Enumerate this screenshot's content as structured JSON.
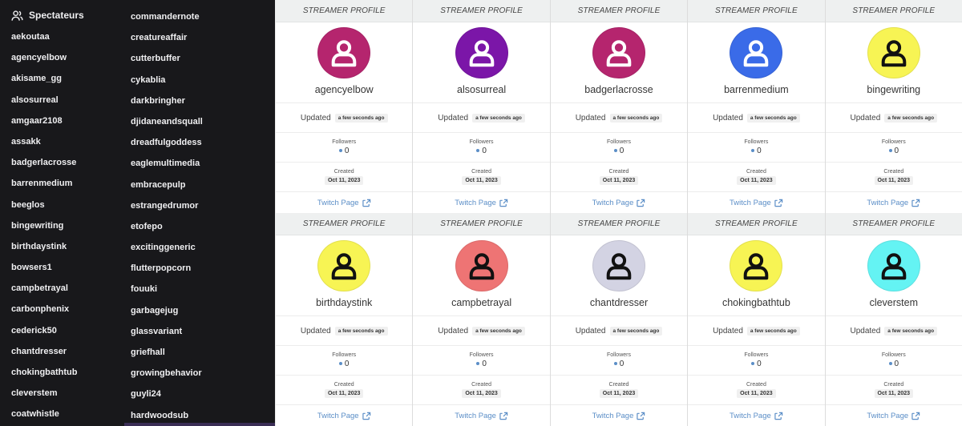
{
  "sidebar": {
    "title": "Spectateurs",
    "icon": "users-icon",
    "column1": [
      "aekoutaa",
      "agencyelbow",
      "akisame_gg",
      "alsosurreal",
      "amgaar2108",
      "assakk",
      "badgerlacrosse",
      "barrenmedium",
      "beeglos",
      "bingewriting",
      "birthdaystink",
      "bowsers1",
      "campbetrayal",
      "carbonphenix",
      "cederick50",
      "chantdresser",
      "chokingbathtub",
      "cleverstem",
      "coatwhistle"
    ],
    "column2": [
      "commandernote",
      "creatureaffair",
      "cutterbuffer",
      "cykablia",
      "darkbringher",
      "djidaneandsquall",
      "dreadfulgoddess",
      "eaglemultimedia",
      "embracepulp",
      "estrangedrumor",
      "etofepo",
      "excitinggeneric",
      "flutterpopcorn",
      "fouuki",
      "garbagejug",
      "glassvariant",
      "griefhall",
      "growingbehavior",
      "guyli24",
      "hardwoodsub"
    ]
  },
  "card_labels": {
    "header": "STREAMER PROFILE",
    "updated": "Updated",
    "followers": "Followers",
    "created": "Created",
    "twitch_link": "Twitch Page"
  },
  "colors": {
    "link": "#5b8ec7",
    "sidebar_bg": "#18181b"
  },
  "cards": [
    {
      "name": "agencyelbow",
      "avatar_color": "#b5256e",
      "icon_color": "#ffffff",
      "updated": "a few seconds ago",
      "followers": "0",
      "created": "Oct 11, 2023"
    },
    {
      "name": "alsosurreal",
      "avatar_color": "#7b16a8",
      "icon_color": "#ffffff",
      "updated": "a few seconds ago",
      "followers": "0",
      "created": "Oct 11, 2023"
    },
    {
      "name": "badgerlacrosse",
      "avatar_color": "#b5256e",
      "icon_color": "#ffffff",
      "updated": "a few seconds ago",
      "followers": "0",
      "created": "Oct 11, 2023"
    },
    {
      "name": "barrenmedium",
      "avatar_color": "#3a6be8",
      "icon_color": "#ffffff",
      "updated": "a few seconds ago",
      "followers": "0",
      "created": "Oct 11, 2023"
    },
    {
      "name": "bingewriting",
      "avatar_color": "#f7f454",
      "icon_color": "#111111",
      "updated": "a few seconds ago",
      "followers": "0",
      "created": "Oct 11, 2023"
    },
    {
      "name": "birthdaystink",
      "avatar_color": "#f7f454",
      "icon_color": "#111111",
      "updated": "a few seconds ago",
      "followers": "0",
      "created": "Oct 11, 2023"
    },
    {
      "name": "campbetrayal",
      "avatar_color": "#ee7474",
      "icon_color": "#111111",
      "updated": "a few seconds ago",
      "followers": "0",
      "created": "Oct 11, 2023"
    },
    {
      "name": "chantdresser",
      "avatar_color": "#d3d3e3",
      "icon_color": "#111111",
      "updated": "a few seconds ago",
      "followers": "0",
      "created": "Oct 11, 2023"
    },
    {
      "name": "chokingbathtub",
      "avatar_color": "#f7f454",
      "icon_color": "#111111",
      "updated": "a few seconds ago",
      "followers": "0",
      "created": "Oct 11, 2023"
    },
    {
      "name": "cleverstem",
      "avatar_color": "#64f3f3",
      "icon_color": "#111111",
      "updated": "a few seconds ago",
      "followers": "0",
      "created": "Oct 11, 2023"
    }
  ]
}
